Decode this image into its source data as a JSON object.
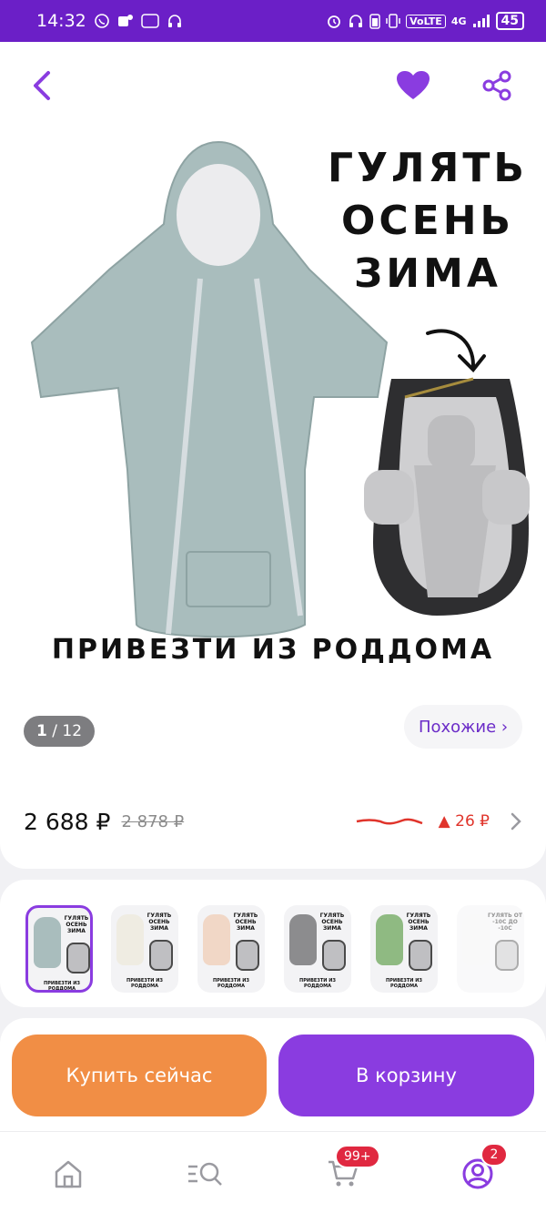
{
  "status_bar": {
    "time": "14:32",
    "network": "4G",
    "volte": "VoLTE",
    "battery": "45"
  },
  "product": {
    "promo_lines": [
      "ГУЛЯТЬ",
      "ОСЕНЬ",
      "ЗИМА"
    ],
    "promo_bottom": "ПРИВЕЗТИ ИЗ РОДДОМА",
    "image_index": "1",
    "image_total": "/ 12",
    "similar_label": "Похожие ›",
    "price": "2 688 ₽",
    "old_price": "2 878 ₽",
    "price_delta": "▲ 26 ₽"
  },
  "thumbnails": [
    {
      "color": "#a9bdbd",
      "label_top": "ГУЛЯТЬ ОСЕНЬ ЗИМА",
      "label_bottom": "ПРИВЕЗТИ ИЗ РОДДОМА",
      "selected": true
    },
    {
      "color": "#efece2",
      "label_top": "ГУЛЯТЬ ОСЕНЬ ЗИМА",
      "label_bottom": "ПРИВЕЗТИ ИЗ РОДДОМА"
    },
    {
      "color": "#f1d7c6",
      "label_top": "ГУЛЯТЬ ОСЕНЬ ЗИМА",
      "label_bottom": "ПРИВЕЗТИ ИЗ РОДДОМА"
    },
    {
      "color": "#8c8c8e",
      "label_top": "ГУЛЯТЬ ОСЕНЬ ЗИМА",
      "label_bottom": "ПРИВЕЗТИ ИЗ РОДДОМА"
    },
    {
      "color": "#8fba82",
      "label_top": "ГУЛЯТЬ ОСЕНЬ ЗИМА",
      "label_bottom": "ПРИВЕЗТИ ИЗ РОДДОМА"
    },
    {
      "color": "#f2f2f2",
      "label_top": "ГУЛЯТЬ ОТ -10С ДО -10С",
      "label_bottom": ""
    }
  ],
  "actions": {
    "buy_now": "Купить сейчас",
    "to_cart": "В корзину"
  },
  "nav": {
    "cart_badge": "99+",
    "profile_badge": "2"
  },
  "colors": {
    "brand": "#6b1fc7",
    "accent": "#8a3ce0",
    "buy": "#f18e45",
    "price_up": "#e0342b"
  }
}
